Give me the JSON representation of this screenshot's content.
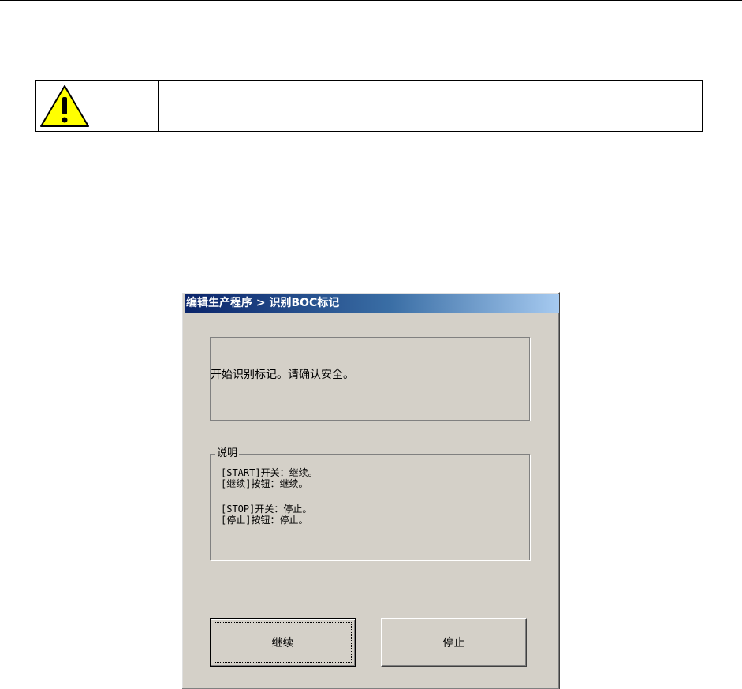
{
  "warning": {
    "icon": "warning-triangle-icon",
    "icon_color": "#ffff00"
  },
  "dialog": {
    "title": "编辑生产程序 > 识别BOC标记",
    "message": "开始识别标记。请确认安全。",
    "notes": {
      "legend": "说明",
      "lines": [
        "[START]开关：继续。",
        "[继续]按钮：继续。",
        "[STOP]开关：停止。",
        "[停止]按钮：停止。"
      ]
    },
    "buttons": {
      "continue_label": "继续",
      "stop_label": "停止"
    },
    "colors": {
      "face": "#d4d0c8",
      "title_start": "#0a246a",
      "title_end": "#a6caf0"
    }
  }
}
